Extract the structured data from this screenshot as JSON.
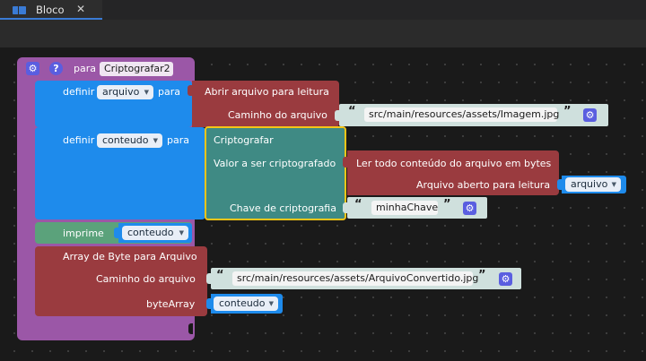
{
  "tab": {
    "title": "Bloco",
    "close": "✕"
  },
  "procedure": {
    "keyword": "para",
    "name": "Criptografar2",
    "gear_icon": "gear-icon",
    "help_icon": "help-icon",
    "help": "?"
  },
  "stmt1": {
    "keyword": "definir",
    "variable": "arquivo",
    "keyword_to": "para",
    "block_title": "Abrir arquivo para leitura",
    "path_label": "Caminho do arquivo",
    "path_value": "src/main/resources/assets/Imagem.jpg"
  },
  "stmt2": {
    "keyword": "definir",
    "variable": "conteudo",
    "keyword_to": "para",
    "crypt_title": "Criptografar",
    "value_label": "Valor a ser criptografado",
    "read_title": "Ler todo conteúdo do arquivo em bytes",
    "opened_label": "Arquivo aberto para leitura",
    "opened_var": "arquivo",
    "key_label": "Chave de criptografia",
    "key_value": "minhaChave"
  },
  "stmt3": {
    "keyword": "imprime",
    "variable": "conteudo"
  },
  "stmt4": {
    "title": "Array de Byte para Arquivo",
    "path_label": "Caminho do arquivo",
    "path_value": "src/main/resources/assets/ArquivoConvertido.jpg",
    "bytes_label": "byteArray",
    "bytes_var": "conteudo"
  },
  "quote_open": "“",
  "quote_close": "”",
  "gear_glyph": "⚙",
  "caret_glyph": "▼",
  "colors": {
    "procedure": "#9b57a7",
    "variables": "#1e8bec",
    "file": "#9a3b3f",
    "print": "#5ba27b",
    "crypto": "#3f8a84",
    "selected_outline": "#f5c518"
  }
}
